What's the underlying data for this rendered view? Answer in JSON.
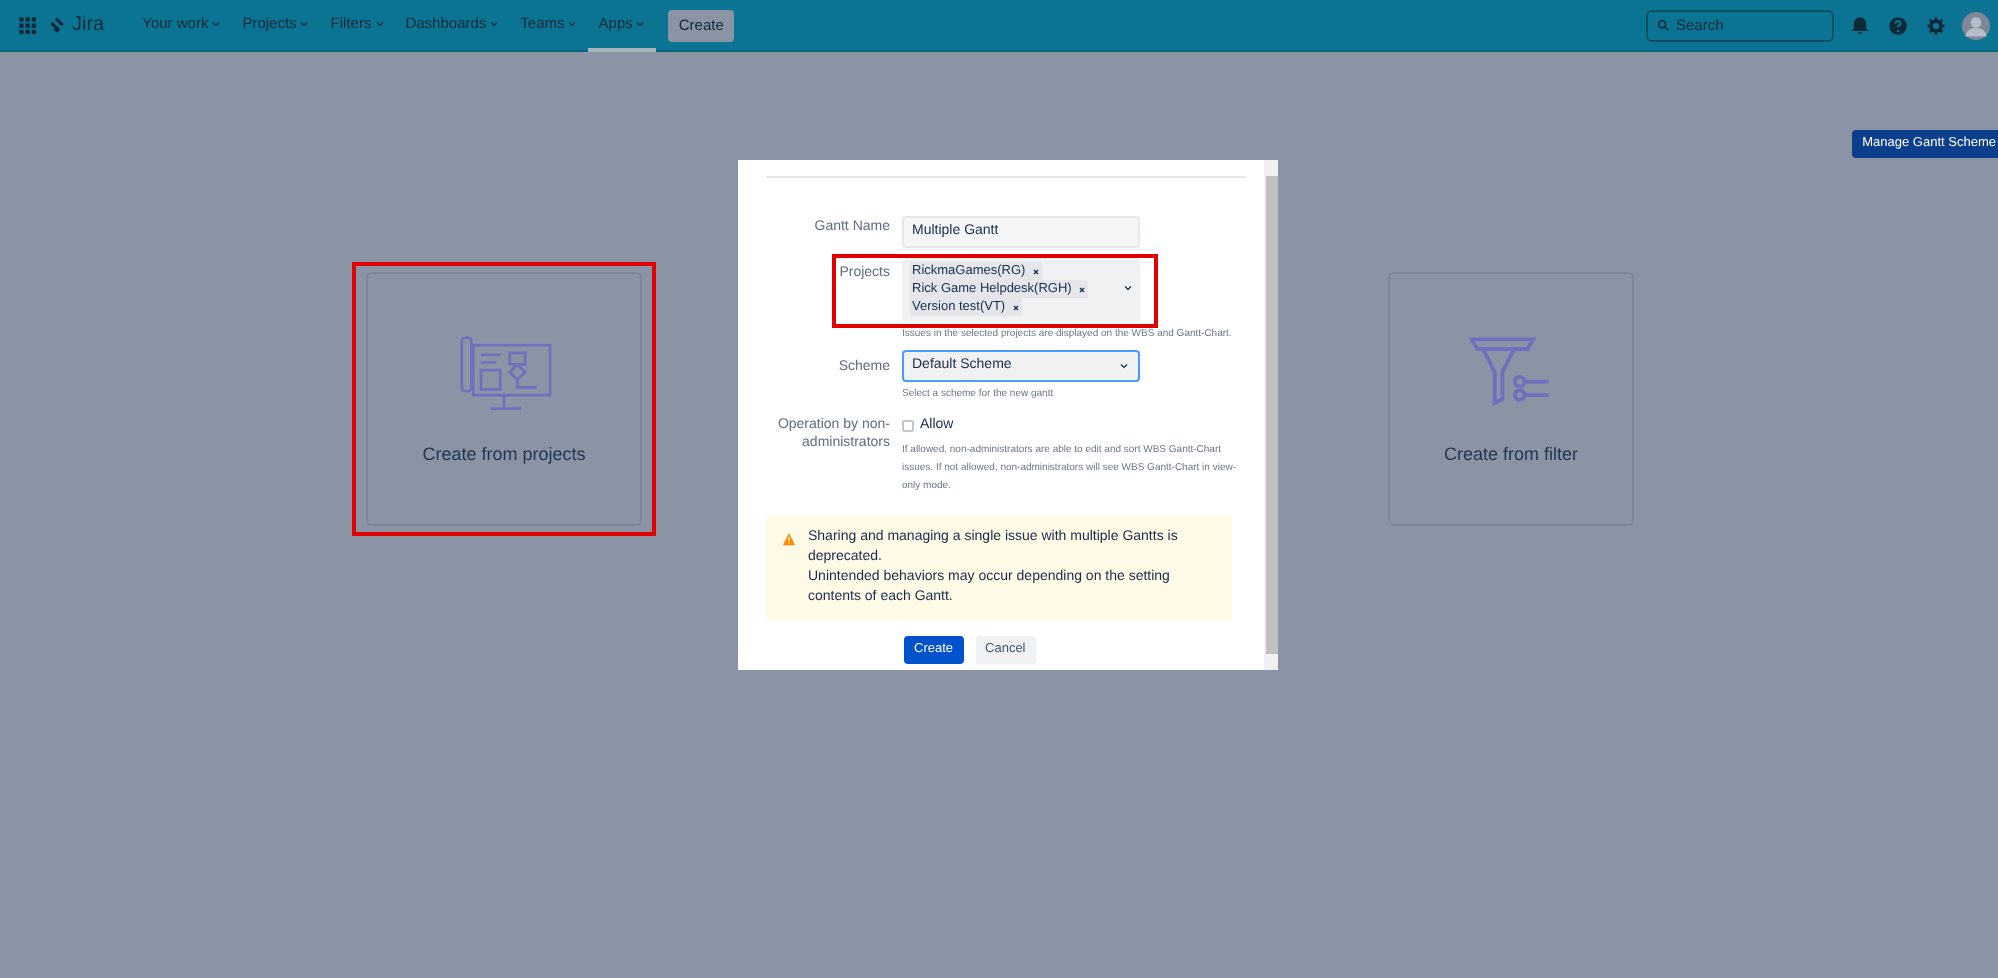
{
  "top_nav": {
    "logo": "Jira",
    "items": [
      {
        "label": "Your work",
        "selected": false
      },
      {
        "label": "Projects",
        "selected": false
      },
      {
        "label": "Filters",
        "selected": false
      },
      {
        "label": "Dashboards",
        "selected": false
      },
      {
        "label": "Teams",
        "selected": false
      },
      {
        "label": "Apps",
        "selected": true
      }
    ],
    "create_button": "Create",
    "search": {
      "placeholder": "Search"
    }
  },
  "manage_button": "Manage Gantt Scheme",
  "cards": [
    {
      "kind": "projects",
      "label": "Create from projects",
      "highlighted": true
    },
    {
      "kind": "filter",
      "label": "Create from filter",
      "highlighted": false
    }
  ],
  "dialog": {
    "gantt_name": {
      "label": "Gantt Name",
      "value": "Multiple Gantt"
    },
    "projects": {
      "label": "Projects",
      "highlighted": true,
      "tags": [
        "RickmaGames(RG)",
        "Rick Game Helpdesk(RGH)",
        "Version test(VT)"
      ],
      "help": "Issues in the selected projects are displayed on the WBS and Gantt-Chart."
    },
    "scheme": {
      "label": "Scheme",
      "value": "Default Scheme",
      "help": "Select a scheme for the new gantt"
    },
    "operation": {
      "label": "Operation by non-administrators",
      "option": "Allow",
      "checked": false,
      "help": "If allowed, non-administrators are able to edit and sort WBS Gantt-Chart issues. If not allowed, non-administrators will see WBS Gantt-Chart in view-only mode."
    },
    "warning": [
      "Sharing and managing a single issue with multiple Gantts is deprecated.",
      "Unintended behaviors may occur depending on the setting contents of each Gantt."
    ],
    "buttons": [
      {
        "kind": "primary",
        "label": "Create"
      },
      {
        "kind": "secondary",
        "label": "Cancel"
      }
    ]
  }
}
